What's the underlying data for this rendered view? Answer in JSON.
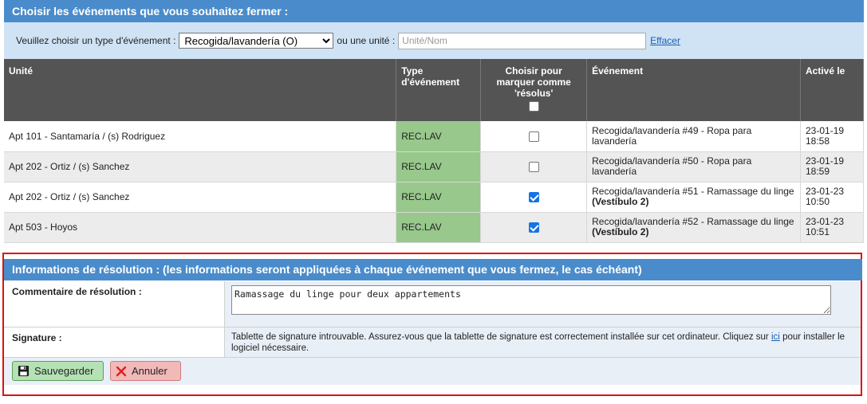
{
  "header": {
    "title": "Choisir les événements que vous souhaitez fermer :"
  },
  "filter": {
    "type_label": "Veuillez choisir un type d'événement :",
    "type_selected": "Recogida/lavandería (O)",
    "unit_label": "ou une unité :",
    "unit_placeholder": "Unité/Nom",
    "unit_value": "",
    "clear_link": "Effacer"
  },
  "table": {
    "columns": {
      "unit": "Unité",
      "type": "Type d'événement",
      "choose": "Choisir pour marquer comme 'résolus'",
      "event": "Événement",
      "activated": "Activé le"
    },
    "rows": [
      {
        "unit": "Apt 101 - Santamaría / (s) Rodriguez",
        "type": "REC.LAV",
        "checked": false,
        "event": "Recogida/lavandería #49 - Ropa para lavandería",
        "event_bold": "",
        "date": "23-01-19",
        "time": "18:58"
      },
      {
        "unit": "Apt 202 - Ortiz / (s) Sanchez",
        "type": "REC.LAV",
        "checked": false,
        "event": "Recogida/lavandería #50 - Ropa para lavandería",
        "event_bold": "",
        "date": "23-01-19",
        "time": "18:59"
      },
      {
        "unit": "Apt 202 - Ortiz / (s) Sanchez",
        "type": "REC.LAV",
        "checked": true,
        "event": "Recogida/lavandería #51 - Ramassage du linge",
        "event_bold": "(Vestíbulo 2)",
        "date": "23-01-23",
        "time": "10:50"
      },
      {
        "unit": "Apt 503 - Hoyos",
        "type": "REC.LAV",
        "checked": true,
        "event": "Recogida/lavandería #52 - Ramassage du linge",
        "event_bold": "(Vestíbulo 2)",
        "date": "23-01-23",
        "time": "10:51"
      }
    ]
  },
  "resolution": {
    "title": "Informations de résolution : (les informations seront appliquées à chaque événement que vous fermez, le cas échéant)",
    "comment_label": "Commentaire de résolution :",
    "comment_value": "Ramassage du linge pour deux appartements",
    "signature_label": "Signature :",
    "signature_text_before": "Tablette de signature introuvable. Assurez-vous que la tablette de signature est correctement installée sur cet ordinateur. Cliquez sur",
    "signature_link": "ici",
    "signature_text_after": "pour installer le logiciel nécessaire.",
    "save_button": "Sauvegarder",
    "cancel_button": "Annuler"
  },
  "colors": {
    "header_blue": "#4a8ccb",
    "type_green": "#98c88c",
    "highlight_red": "#e01010"
  },
  "icons": {
    "save": "floppy-disk-icon",
    "cancel": "close-x-icon"
  }
}
